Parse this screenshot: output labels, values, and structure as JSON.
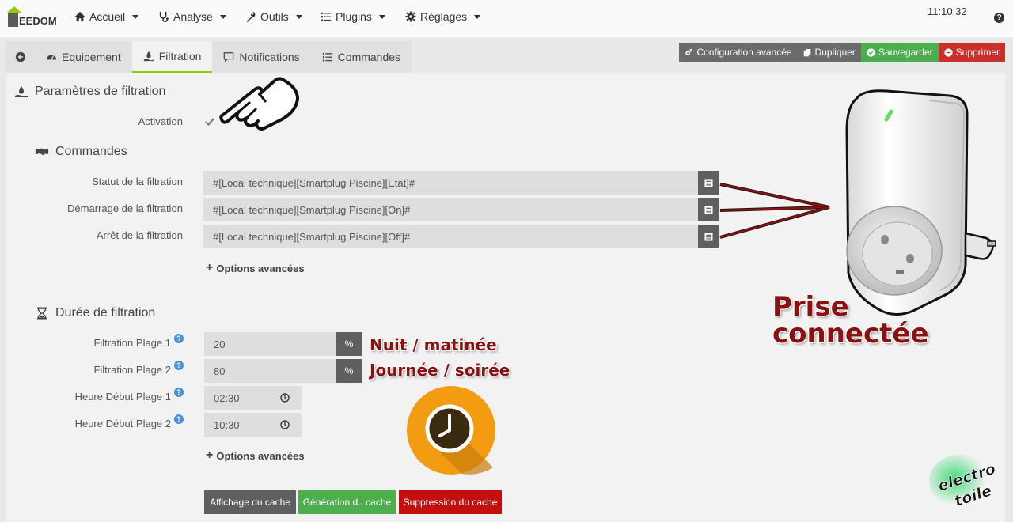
{
  "app": {
    "logo_text": "EEDOM",
    "time": "11:10:32",
    "help_label": "?"
  },
  "nav": [
    {
      "label": "Accueil",
      "icon": "home-icon"
    },
    {
      "label": "Analyse",
      "icon": "stethoscope-icon"
    },
    {
      "label": "Outils",
      "icon": "wrench-icon"
    },
    {
      "label": "Plugins",
      "icon": "list-icon"
    },
    {
      "label": "Réglages",
      "icon": "gear-icon"
    }
  ],
  "tabs": [
    {
      "label": "",
      "icon": "back-arrow-icon"
    },
    {
      "label": "Equipement",
      "icon": "dashboard-icon"
    },
    {
      "label": "Filtration",
      "icon": "filtration-icon",
      "active": true
    },
    {
      "label": "Notifications",
      "icon": "comment-icon"
    },
    {
      "label": "Commandes",
      "icon": "list-icon"
    }
  ],
  "actions": {
    "config": "Configuration avancée",
    "duplicate": "Dupliquer",
    "save": "Sauvegarder",
    "delete": "Supprimer"
  },
  "filtration": {
    "title": "Paramètres de filtration",
    "activation_label": "Activation",
    "activation_checked": true
  },
  "commandes": {
    "title": "Commandes",
    "rows": [
      {
        "label": "Statut de la filtration",
        "value": "#[Local technique][Smartplug Piscine][Etat]#"
      },
      {
        "label": "Démarrage de la filtration",
        "value": "#[Local technique][Smartplug Piscine][On]#"
      },
      {
        "label": "Arrêt de la filtration",
        "value": "#[Local technique][Smartplug Piscine][Off]#"
      }
    ],
    "options_label": "Options avancées"
  },
  "duree": {
    "title": "Durée de filtration",
    "plage1_label": "Filtration Plage 1",
    "plage1_value": "20",
    "plage2_label": "Filtration Plage 2",
    "plage2_value": "80",
    "percent": "%",
    "debut1_label": "Heure Début Plage 1",
    "debut1_value": "02:30",
    "debut2_label": "Heure Début Plage 2",
    "debut2_value": "10:30",
    "options_label": "Options avancées"
  },
  "cache": {
    "show": "Affichage du cache",
    "generate": "Génération du cache",
    "delete": "Suppression du cache"
  },
  "annotations": {
    "plage1": "Nuit / matinée",
    "plage2": "Journée / soirée",
    "plug_line1": "Prise",
    "plug_line2": "connectée",
    "watermark_line1": "electro",
    "watermark_line2": "toile"
  },
  "colors": {
    "accent_green": "#94ca02",
    "save_green": "#4cae4c",
    "delete_red": "#c9302c",
    "annotation_red": "#8b1010",
    "clock_orange": "#f39c12"
  }
}
